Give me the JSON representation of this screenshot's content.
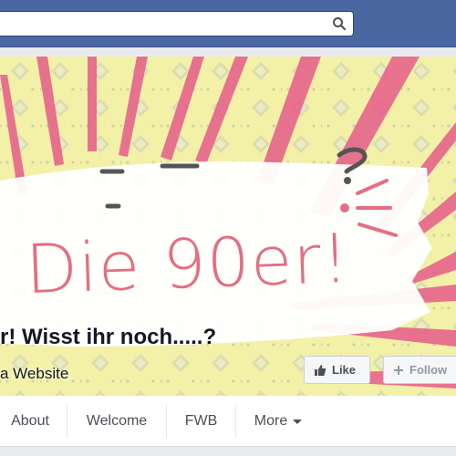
{
  "search": {
    "placeholder": ""
  },
  "cover": {
    "logo_text": "Die 90er!",
    "colors": {
      "background": "#f3f1a8",
      "rays": "#e65c8a",
      "text": "#e46e82"
    }
  },
  "page": {
    "title": "r! Wisst ihr noch.....?",
    "category": "a Website"
  },
  "actions": {
    "like_label": "Like",
    "follow_label": "Follow"
  },
  "tabs": [
    {
      "label": "About"
    },
    {
      "label": "Welcome"
    },
    {
      "label": "FWB"
    },
    {
      "label": "More"
    }
  ],
  "icons": {
    "search": "search-icon",
    "like": "thumbs-up-icon",
    "follow": "plus-icon",
    "more": "caret-down-icon"
  }
}
